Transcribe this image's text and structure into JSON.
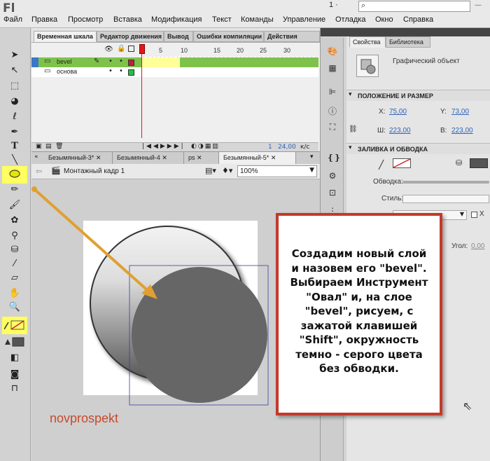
{
  "app": {
    "logo": "Fl",
    "workspace_select": "1 ·",
    "search_icon": "⌕",
    "close_glyph": "—"
  },
  "menu": {
    "items": [
      "Файл",
      "Правка",
      "Просмотр",
      "Вставка",
      "Модификация",
      "Текст",
      "Команды",
      "Управление",
      "Отладка",
      "Окно",
      "Справка"
    ]
  },
  "timeline": {
    "tabs": [
      "Временная шкала",
      "Редактор движения",
      "Вывод",
      "Ошибки компиляции",
      "Действия"
    ],
    "ruler": [
      "1",
      "5",
      "10",
      "15",
      "20",
      "25",
      "30"
    ],
    "layers": [
      {
        "name": "bevel",
        "selected": true,
        "color": "#c02040"
      },
      {
        "name": "основа",
        "selected": false,
        "color": "#22c04a"
      }
    ],
    "status": {
      "frame": "1",
      "fps": "24,00",
      "fps_unit": "к/с"
    }
  },
  "documents": {
    "tabs": [
      "Безымянный-3*",
      "Безымянный-4",
      "ps",
      "Безымянный-5*"
    ],
    "active_index": 3
  },
  "editbar": {
    "scene_label": "Монтажный кадр 1",
    "zoom": "100%"
  },
  "stage": {
    "watermark": "novprospekt"
  },
  "properties": {
    "tabs": [
      "Свойства",
      "Библиотека"
    ],
    "object_type": "Графический объект",
    "section_position": "ПОЛОЖЕНИЕ И РАЗМЕР",
    "x_label": "X:",
    "x_value": "75,00",
    "y_label": "Y:",
    "y_value": "73,00",
    "w_label": "Ш:",
    "w_value": "223,00",
    "h_label": "В:",
    "h_value": "223,00",
    "section_fill": "ЗАЛИВКА И ОБВОДКА",
    "stroke_label": "Обводка:",
    "style_label": "Стиль:",
    "hint_label": "Х",
    "angle_label": "Угол:",
    "angle_value": "0,00",
    "fill_color": "#555555"
  },
  "callout": {
    "text": "Создадим новый слой\nи назовем его \"bevel\".\nВыбираем Инструмент\n\"Овал\" и, на слое\n\"bevel\", рисуем, с\nзажатой клавишей\n\"Shift\", окружность\nтемно - серого цвета\nбез обводки."
  },
  "colors": {
    "highlight": "#ffff60",
    "arrow": "#e0a030",
    "callout_border": "#c23a2a",
    "dark_circle": "#666666"
  }
}
